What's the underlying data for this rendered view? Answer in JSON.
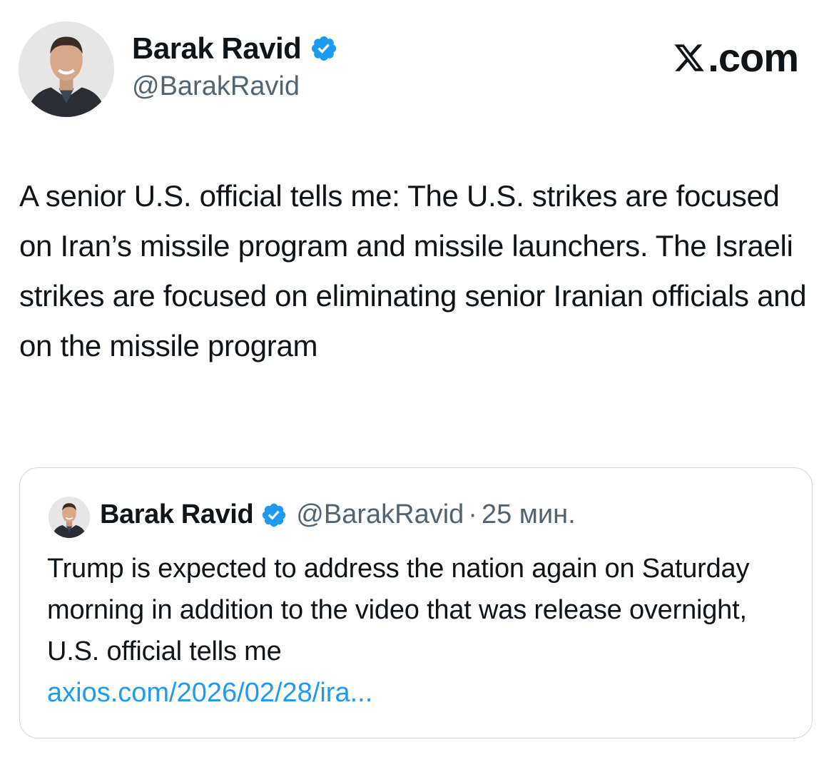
{
  "tweet": {
    "author": {
      "name": "Barak Ravid",
      "handle": "@BarakRavid",
      "verified": true,
      "avatar_icon": "profile-photo"
    },
    "brand": ".com",
    "brand_icon": "x-logo-icon",
    "text": "A senior U.S. official tells me: The U.S. strikes are focused on Iran’s missile program and missile launchers. The Israeli strikes are focused on eliminating senior Iranian officials and on the missile program",
    "quoted": {
      "author_name": "Barak Ravid",
      "handle": "@BarakRavid",
      "separator": "·",
      "time": "25 мин.",
      "text": "Trump is expected to address the nation again on Saturday morning in addition to the video that was release overnight, U.S. official tells me",
      "link": "axios.com/2026/02/28/ira..."
    }
  },
  "colors": {
    "text": "#0f1419",
    "secondary": "#536471",
    "link": "#1d9bf0",
    "verified_badge": "#1d9bf0",
    "border": "#cfd9de"
  }
}
